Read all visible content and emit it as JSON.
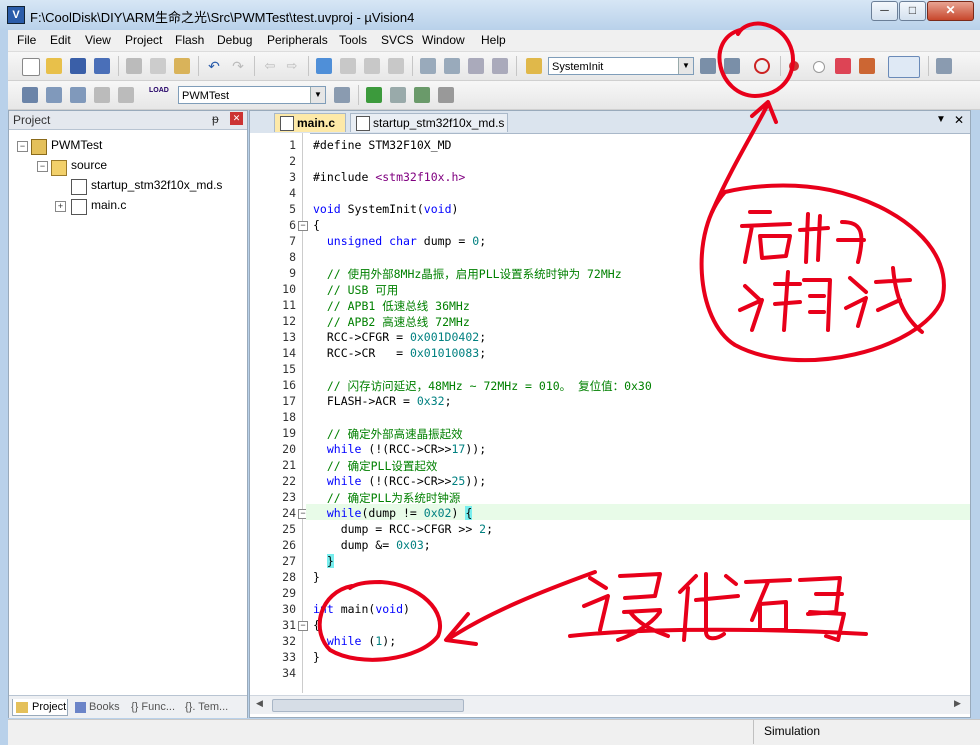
{
  "window": {
    "title": "F:\\CoolDisk\\DIY\\ARM生命之光\\Src\\PWMTest\\test.uvproj - µVision4",
    "app_icon": "V",
    "minimize": "─",
    "maximize": "□",
    "close": "✕"
  },
  "menu": [
    "File",
    "Edit",
    "View",
    "Project",
    "Flash",
    "Debug",
    "Peripherals",
    "Tools",
    "SVCS",
    "Window",
    "Help"
  ],
  "toolbar1": {
    "function_combo": "SystemInit"
  },
  "toolbar2": {
    "target_combo": "PWMTest",
    "load_label": "LOAD"
  },
  "project": {
    "title": "Project",
    "pin": "ᵽ",
    "close": "✕",
    "tree": {
      "root": "PWMTest",
      "group": "source",
      "file1": "startup_stm32f10x_md.s",
      "file2": "main.c"
    },
    "tabs": [
      "Project",
      "Books",
      "{} Func...",
      "{}. Tem..."
    ]
  },
  "editor": {
    "tabs": [
      "main.c",
      "startup_stm32f10x_md.s"
    ],
    "line_numbers": [
      "1",
      "2",
      "3",
      "4",
      "5",
      "6",
      "7",
      "8",
      "9",
      "10",
      "11",
      "12",
      "13",
      "14",
      "15",
      "16",
      "17",
      "18",
      "19",
      "20",
      "21",
      "22",
      "23",
      "24",
      "25",
      "26",
      "27",
      "28",
      "29",
      "30",
      "31",
      "32",
      "33",
      "34"
    ]
  },
  "code": {
    "l1a": "#define",
    "l1b": " STM32F10X_MD",
    "l3a": "#include",
    "l3b": " <stm32f10x.h>",
    "l5a": "void",
    "l5b": " SystemInit(",
    "l5c": "void",
    "l5d": ")",
    "l6": "{",
    "l7a": "  unsigned char",
    "l7b": " dump = ",
    "l7c": "0",
    "l7d": ";",
    "l9": "  // 使用外部8MHz晶振，启用PLL设置系统时钟为 72MHz",
    "l10": "  // USB 可用",
    "l11": "  // APB1 低速总线 36MHz",
    "l12": "  // APB2 高速总线 72MHz",
    "l13a": "  RCC->CFGR = ",
    "l13b": "0x001D0402",
    "l13c": ";",
    "l14a": "  RCC->CR   = ",
    "l14b": "0x01010083",
    "l14c": ";",
    "l16": "  // 闪存访问延迟，48MHz ~ 72MHz = 010。 复位值：0x30",
    "l17a": "  FLASH->ACR = ",
    "l17b": "0x32",
    "l17c": ";",
    "l19": "  // 确定外部高速晶振起效",
    "l20a": "  while",
    "l20b": " (!(RCC->CR>>",
    "l20c": "17",
    "l20d": "));",
    "l21": "  // 确定PLL设置起效",
    "l22a": "  while",
    "l22b": " (!(RCC->CR>>",
    "l22c": "25",
    "l22d": "));",
    "l23": "  // 确定PLL为系统时钟源",
    "l24a": "  while",
    "l24b": "(dump != ",
    "l24c": "0x02",
    "l24d": ") ",
    "l24e": "{",
    "l25a": "    dump = RCC->CFGR >> ",
    "l25b": "2",
    "l25c": ";",
    "l26a": "    dump &= ",
    "l26b": "0x03",
    "l26c": ";",
    "l27a": "  ",
    "l27b": "}",
    "l28": "}",
    "l30a": "int",
    "l30b": " main(",
    "l30c": "void",
    "l30d": ")",
    "l31": "{",
    "l32a": "  while",
    "l32b": " (",
    "l32c": "1",
    "l32d": ");",
    "l33": "}"
  },
  "status": {
    "mode": "Simulation"
  },
  "colors": {
    "keyword": "#0000ff",
    "comment": "#008000",
    "number": "#008080",
    "string": "#800080",
    "annotation": "#e8001a"
  }
}
